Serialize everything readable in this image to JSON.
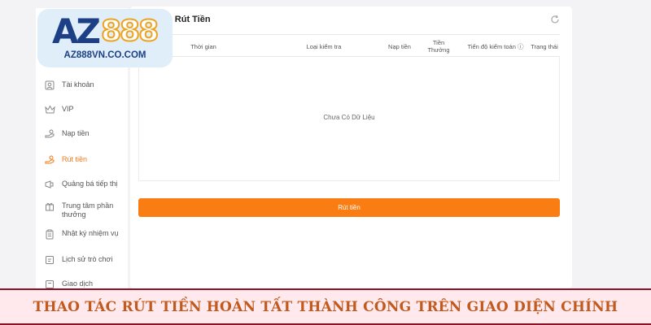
{
  "logo": {
    "brand_az": "AZ",
    "brand_num": "888",
    "url": "AZ888VN.CO.COM"
  },
  "panel": {
    "title": "n Rút Tiền"
  },
  "table": {
    "headers": [
      "Thời gian",
      "Loại kiểm tra",
      "Nạp tiền",
      "Tiền Thưởng",
      "Tiến độ kiểm toán ⓘ",
      "Trạng thái"
    ],
    "empty_text": "Chưa Có Dữ Liệu"
  },
  "withdraw_button": {
    "label": "Rút tiền"
  },
  "sidebar": {
    "items": [
      {
        "label": "Tài khoản",
        "icon": "user-icon"
      },
      {
        "label": "VIP",
        "icon": "vip-icon"
      },
      {
        "label": "Nạp tiền",
        "icon": "deposit-icon"
      },
      {
        "label": "Rút tiền",
        "icon": "withdraw-icon",
        "active": true
      },
      {
        "label": "Quảng bá tiếp thị",
        "icon": "promotion-icon"
      },
      {
        "label": "Trung tâm phần thưởng",
        "icon": "gift-icon"
      },
      {
        "label": "Nhật ký nhiệm vụ",
        "icon": "clipboard-icon"
      },
      {
        "label": "Lịch sử trò chơi",
        "icon": "history-icon"
      },
      {
        "label": "Giao dịch",
        "icon": "transaction-icon"
      }
    ]
  },
  "banner": {
    "text": "THAO TÁC RÚT TIỀN HOÀN TẤT THÀNH CÔNG TRÊN GIAO DIỆN CHÍNH"
  },
  "colors": {
    "accent": "#f97d12",
    "brand_blue": "#1c3f86",
    "banner_text": "#c15a1e",
    "banner_border": "#8a1426"
  }
}
